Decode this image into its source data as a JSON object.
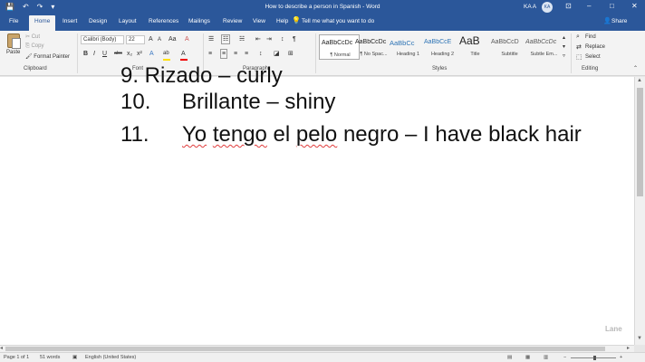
{
  "window": {
    "title": "How to describe a person in Spanish - Word",
    "user": "KA A",
    "avatar": "KA",
    "controls": {
      "restore_icon": "ribbon-display-icon",
      "minimize": "–",
      "maximize": "□",
      "close": "✕"
    }
  },
  "quick_access": {
    "save_icon": "💾",
    "undo_icon": "↶",
    "redo_icon": "↷",
    "customize_icon": "▾"
  },
  "tabs": [
    {
      "label": "File"
    },
    {
      "label": "Home",
      "active": true
    },
    {
      "label": "Insert"
    },
    {
      "label": "Design"
    },
    {
      "label": "Layout"
    },
    {
      "label": "References"
    },
    {
      "label": "Mailings"
    },
    {
      "label": "Review"
    },
    {
      "label": "View"
    },
    {
      "label": "Help"
    }
  ],
  "tell_me": "Tell me what you want to do",
  "share": "Share",
  "ribbon": {
    "clipboard": {
      "paste": "Paste",
      "cut": "Cut",
      "copy": "Copy",
      "format_painter": "Format Painter",
      "label": "Clipboard"
    },
    "font": {
      "font_name": "Calibri (Body)",
      "font_size": "22",
      "label": "Font",
      "buttons": {
        "grow": "A",
        "shrink": "A",
        "case": "Aa",
        "clear": "A",
        "bold": "B",
        "italic": "I",
        "underline": "U",
        "strike": "abc",
        "sub": "x₂",
        "sup": "x²",
        "effects": "A",
        "highlight": "ab",
        "color": "A"
      }
    },
    "paragraph": {
      "label": "Paragraph",
      "buttons": {
        "bullets": "☰",
        "numbering": "☷",
        "multilevel": "☵",
        "decrease": "⇤",
        "increase": "⇥",
        "sort": "↕",
        "marks": "¶"
      }
    },
    "styles": {
      "label": "Styles",
      "items": [
        {
          "preview": "AaBbCcDc",
          "name": "¶ Normal"
        },
        {
          "preview": "AaBbCcDc",
          "name": "¶ No Spac..."
        },
        {
          "preview": "AaBbCc",
          "name": "Heading 1"
        },
        {
          "preview": "AaBbCcE",
          "name": "Heading 2"
        },
        {
          "preview": "AaB",
          "name": "Title"
        },
        {
          "preview": "AaBbCcD",
          "name": "Subtitle"
        },
        {
          "preview": "AaBbCcDc",
          "name": "Subtle Em..."
        }
      ]
    },
    "editing": {
      "label": "Editing",
      "find": "Find",
      "replace": "Replace",
      "select": "Select"
    }
  },
  "document": {
    "cut_line": "9. Rizado – curly",
    "items": [
      {
        "number": "10.",
        "text": "Brillante – shiny"
      },
      {
        "number": "11.",
        "text_parts": [
          "Yo",
          " ",
          "tengo",
          " el ",
          "pelo",
          " negro – I have black hair"
        ]
      }
    ]
  },
  "status": {
    "page": "Page 1 of 1",
    "words": "51 words",
    "language": "English (United States)"
  },
  "watermark": "Lane"
}
